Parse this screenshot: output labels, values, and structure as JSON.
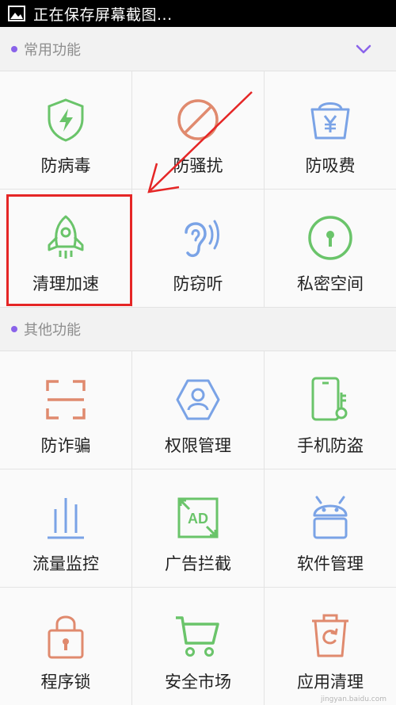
{
  "status_bar": {
    "text": "正在保存屏幕截图...",
    "icon": "image-icon"
  },
  "sections": {
    "common": {
      "title": "常用功能",
      "toggle_icon": "chevron-down-icon"
    },
    "other": {
      "title": "其他功能"
    }
  },
  "common_items": [
    {
      "label": "防病毒",
      "icon": "shield-bolt-icon",
      "color": "#6ac46a"
    },
    {
      "label": "防骚扰",
      "icon": "block-icon",
      "color": "#e08a6e"
    },
    {
      "label": "防吸费",
      "icon": "yen-basket-icon",
      "color": "#7aa3e6"
    },
    {
      "label": "清理加速",
      "icon": "rocket-icon",
      "color": "#6ac46a",
      "highlighted": true
    },
    {
      "label": "防窃听",
      "icon": "ear-icon",
      "color": "#7aa3e6"
    },
    {
      "label": "私密空间",
      "icon": "keyhole-icon",
      "color": "#6ac46a"
    }
  ],
  "other_items": [
    {
      "label": "防诈骗",
      "icon": "scan-frame-icon",
      "color": "#e08a6e"
    },
    {
      "label": "权限管理",
      "icon": "user-hexagon-icon",
      "color": "#7aa3e6"
    },
    {
      "label": "手机防盗",
      "icon": "phone-key-icon",
      "color": "#6ac46a"
    },
    {
      "label": "流量监控",
      "icon": "bar-chart-icon",
      "color": "#7aa3e6"
    },
    {
      "label": "广告拦截",
      "icon": "ad-block-icon",
      "color": "#6ac46a"
    },
    {
      "label": "软件管理",
      "icon": "android-icon",
      "color": "#7aa3e6"
    },
    {
      "label": "程序锁",
      "icon": "lock-icon",
      "color": "#e08a6e"
    },
    {
      "label": "安全市场",
      "icon": "cart-icon",
      "color": "#6ac46a"
    },
    {
      "label": "应用清理",
      "icon": "trash-refresh-icon",
      "color": "#e08a6e"
    }
  ],
  "watermark": "jingyan.baidu.com",
  "colors": {
    "accent": "#8a63ea",
    "annotation": "#e52626"
  }
}
